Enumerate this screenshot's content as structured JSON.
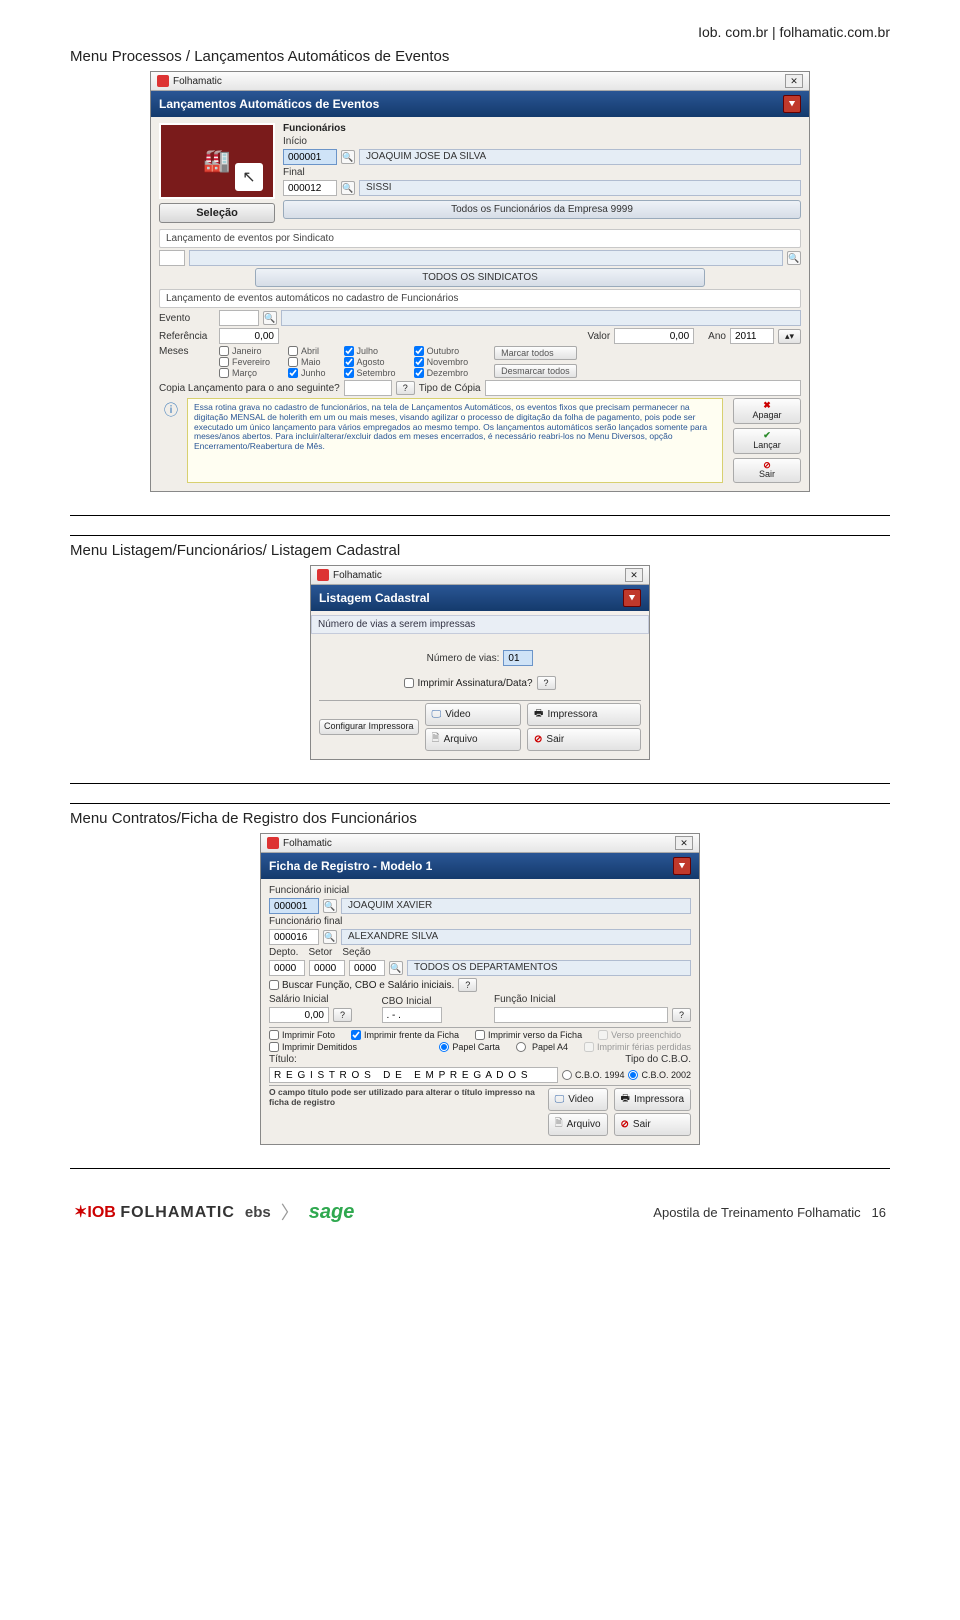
{
  "header_right": "Iob. com.br | folhamatic.com.br",
  "section1_title": "Menu Processos / Lançamentos Automáticos de Eventos",
  "section2_title": "Menu Listagem/Funcionários/ Listagem Cadastral",
  "section3_title": "Menu Contratos/Ficha de  Registro dos Funcionários",
  "footer_text": "Apostila de Treinamento  Folhamatic",
  "page_number": "16",
  "logos": {
    "iob": "IOB",
    "folha": "FOLHAMATIC",
    "ebs": "ebs",
    "sage": "sage"
  },
  "win1": {
    "app_title": "Folhamatic",
    "bluebar": "Lançamentos Automáticos de Eventos",
    "selecao_label": "Seleção",
    "func_header": "Funcionários",
    "inicio_label": "Início",
    "inicio_code": "000001",
    "inicio_name": "JOAQUIM JOSE DA SILVA",
    "final_label": "Final",
    "final_code": "000012",
    "final_name": "SISSI",
    "todos_btn": "Todos os Funcionários da Empresa 9999",
    "sindicato_header": "Lançamento de eventos por Sindicato",
    "todos_sindicatos": "TODOS OS SINDICATOS",
    "auto_header": "Lançamento de eventos automáticos no cadastro de Funcionários",
    "evento_label": "Evento",
    "ref_label": "Referência",
    "ref_val": "0,00",
    "valor_label": "Valor",
    "valor_val": "0,00",
    "ano_label": "Ano",
    "ano_val": "2011",
    "meses_label": "Meses",
    "months": {
      "jan": "Janeiro",
      "fev": "Fevereiro",
      "mar": "Março",
      "abr": "Abril",
      "mai": "Maio",
      "jun": "Junho",
      "jul": "Julho",
      "ago": "Agosto",
      "set": "Setembro",
      "out": "Outubro",
      "nov": "Novembro",
      "dez": "Dezembro"
    },
    "marcar": "Marcar todos",
    "desmarcar": "Desmarcar todos",
    "copia_label": "Copia Lançamento para o ano seguinte?",
    "tipo_copia": "Tipo de Cópia",
    "info_text": "Essa rotina grava no cadastro de funcionários, na tela de Lançamentos Automáticos, os eventos fixos que precisam permanecer na digitação MENSAL de holerith em um ou mais meses, visando agilizar o processo de digitação da folha de pagamento, pois pode ser executado um único lançamento para vários empregados ao mesmo tempo. Os lançamentos automáticos serão lançados somente para meses/anos abertos. Para incluir/alterar/excluir dados em meses encerrados, é necessário reabri-los no Menu Diversos, opção Encerramento/Reabertura de Mês.",
    "btn_apagar": "Apagar",
    "btn_lancar": "Lançar",
    "btn_sair": "Sair"
  },
  "win2": {
    "app_title": "Folhamatic",
    "bluebar": "Listagem Cadastral",
    "subheader": "Número de vias a serem impressas",
    "numvias_label": "Número de vias:",
    "numvias_val": "01",
    "assinatura_label": "Imprimir Assinatura/Data?",
    "btn_config": "Configurar Impressora",
    "btn_video": "Video",
    "btn_arquivo": "Arquivo",
    "btn_impressora": "Impressora",
    "btn_sair": "Sair"
  },
  "win3": {
    "app_title": "Folhamatic",
    "bluebar": "Ficha de Registro - Modelo 1",
    "func_ini_label": "Funcionário inicial",
    "func_ini_code": "000001",
    "func_ini_name": "JOAQUIM  XAVIER",
    "func_fin_label": "Funcionário final",
    "func_fin_code": "000016",
    "func_fin_name": "ALEXANDRE  SILVA",
    "depto": "Depto.",
    "setor": "Setor",
    "secao": "Seção",
    "code0": "0000",
    "todos_deptos": "TODOS OS DEPARTAMENTOS",
    "buscar_label": "Buscar Função, CBO e Salário iniciais.",
    "sal_label": "Salário Inicial",
    "sal_val": "0,00",
    "cbo_label": "CBO Inicial",
    "cbo_val": ". - .",
    "funcao_label": "Função Inicial",
    "chk_foto": "Imprimir Foto",
    "chk_frente": "Imprimir frente da Ficha",
    "chk_verso": "Imprimir verso da Ficha",
    "chk_versopre": "Verso preenchido",
    "chk_demit": "Imprimir Demitidos",
    "chk_ferias": "Imprimir férias perdidas",
    "papel_carta": "Papel Carta",
    "papel_a4": "Papel A4",
    "titulo_label": "Título:",
    "titulo_val": "R E G I S T R O S   D E   E M P R E G A D O S",
    "tipo_cbo_label": "Tipo do C.B.O.",
    "cbo1994": "C.B.O. 1994",
    "cbo2002": "C.B.O. 2002",
    "note": "O campo título pode ser utilizado para alterar o título impresso na ficha de registro",
    "btn_video": "Video",
    "btn_arquivo": "Arquivo",
    "btn_impressora": "Impressora",
    "btn_sair": "Sair"
  }
}
